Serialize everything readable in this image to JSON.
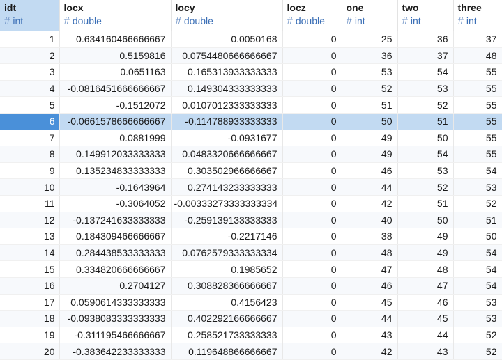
{
  "columns": [
    {
      "name": "idt",
      "type": "int"
    },
    {
      "name": "locx",
      "type": "double"
    },
    {
      "name": "locy",
      "type": "double"
    },
    {
      "name": "locz",
      "type": "double"
    },
    {
      "name": "one",
      "type": "int"
    },
    {
      "name": "two",
      "type": "int"
    },
    {
      "name": "three",
      "type": "int"
    }
  ],
  "type_prefix": "#",
  "selected_row_index": 5,
  "colors": {
    "selection": "#c2daf2",
    "selected_id": "#4a90d9",
    "type_text": "#3b6fb6"
  },
  "rows": [
    [
      "1",
      "0.634160466666667",
      "0.0050168",
      "0",
      "25",
      "36",
      "37"
    ],
    [
      "2",
      "0.5159816",
      "0.0754480666666667",
      "0",
      "36",
      "37",
      "48"
    ],
    [
      "3",
      "0.0651163",
      "0.165313933333333",
      "0",
      "53",
      "54",
      "55"
    ],
    [
      "4",
      "-0.0816451666666667",
      "0.149304333333333",
      "0",
      "52",
      "53",
      "55"
    ],
    [
      "5",
      "-0.1512072",
      "0.0107012333333333",
      "0",
      "51",
      "52",
      "55"
    ],
    [
      "6",
      "-0.0661578666666667",
      "-0.114788933333333",
      "0",
      "50",
      "51",
      "55"
    ],
    [
      "7",
      "0.0881999",
      "-0.0931677",
      "0",
      "49",
      "50",
      "55"
    ],
    [
      "8",
      "0.149912033333333",
      "0.0483320666666667",
      "0",
      "49",
      "54",
      "55"
    ],
    [
      "9",
      "0.135234833333333",
      "0.303502966666667",
      "0",
      "46",
      "53",
      "54"
    ],
    [
      "10",
      "-0.1643964",
      "0.274143233333333",
      "0",
      "44",
      "52",
      "53"
    ],
    [
      "11",
      "-0.3064052",
      "-0.00333273333333334",
      "0",
      "42",
      "51",
      "52"
    ],
    [
      "12",
      "-0.137241633333333",
      "-0.259139133333333",
      "0",
      "40",
      "50",
      "51"
    ],
    [
      "13",
      "0.184309466666667",
      "-0.2217146",
      "0",
      "38",
      "49",
      "50"
    ],
    [
      "14",
      "0.284438533333333",
      "0.0762579333333334",
      "0",
      "48",
      "49",
      "54"
    ],
    [
      "15",
      "0.334820666666667",
      "0.1985652",
      "0",
      "47",
      "48",
      "54"
    ],
    [
      "16",
      "0.2704127",
      "0.308828366666667",
      "0",
      "46",
      "47",
      "54"
    ],
    [
      "17",
      "0.0590614333333333",
      "0.4156423",
      "0",
      "45",
      "46",
      "53"
    ],
    [
      "18",
      "-0.0938083333333333",
      "0.402292166666667",
      "0",
      "44",
      "45",
      "53"
    ],
    [
      "19",
      "-0.311195466666667",
      "0.258521733333333",
      "0",
      "43",
      "44",
      "52"
    ],
    [
      "20",
      "-0.383642233333333",
      "0.119648866666667",
      "0",
      "42",
      "43",
      "52"
    ]
  ]
}
